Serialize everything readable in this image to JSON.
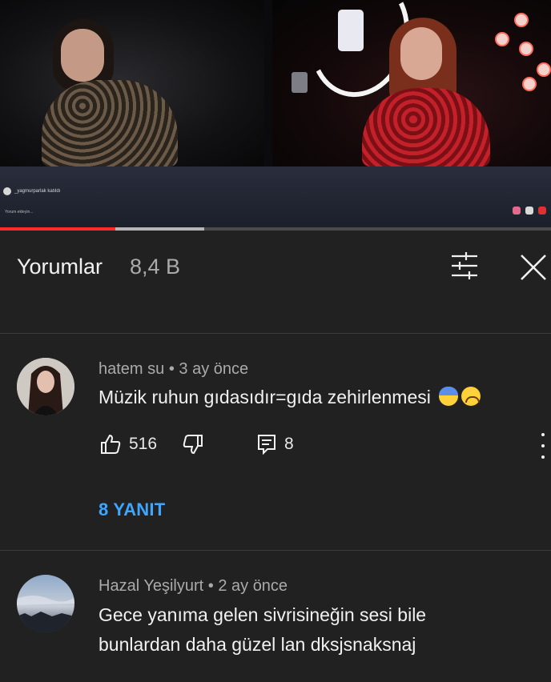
{
  "video": {
    "channel_name": "_yagmurparlak katıldı",
    "comment_hint": "Yorum ekleyin...",
    "progress_played": 0.21,
    "progress_buffered": 0.37
  },
  "comments_header": {
    "title": "Yorumlar",
    "count": "8,4 B",
    "filter_icon": "filter-sliders-icon",
    "close_icon": "close-icon"
  },
  "comments": [
    {
      "author": "hatem su",
      "separator": "•",
      "time": "3 ay önce",
      "text": "Müzik ruhun gıdasıdır=gıda zehirlenmesi",
      "emojis": [
        "fearful-face",
        "tired-face"
      ],
      "likes": "516",
      "replies_count": "8",
      "replies_link": "8 YANIT"
    },
    {
      "author": "Hazal Yeşilyurt",
      "separator": "•",
      "time": "2 ay önce",
      "text_lines": [
        "Gece yanıma gelen sivrisineğin sesi bile",
        "bunlardan daha güzel lan dksjsnaksnaj"
      ]
    }
  ],
  "colors": {
    "background": "#212121",
    "link": "#3ea6ff",
    "progress": "#ff2a2a",
    "meta_text": "#aaaaaa"
  }
}
